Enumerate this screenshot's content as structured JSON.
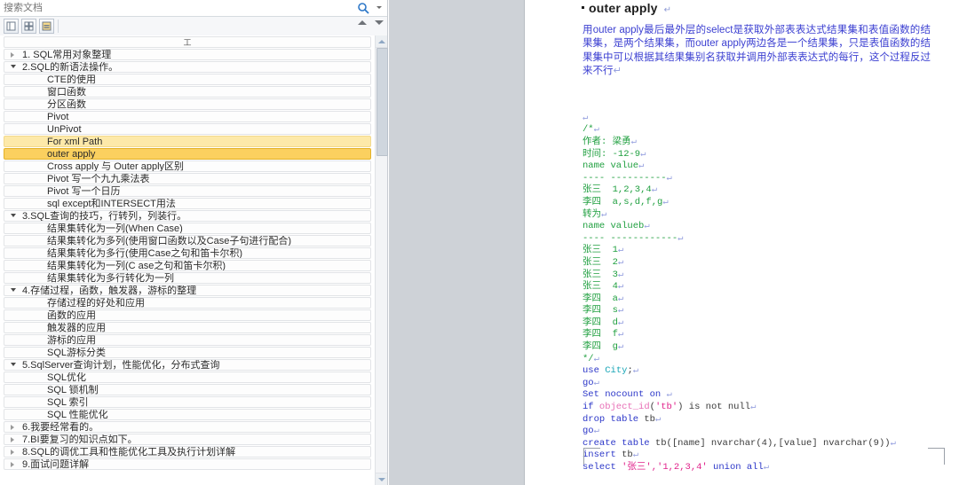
{
  "nav": {
    "search": {
      "placeholder": "搜索文档",
      "value": "",
      "icon": "search-icon",
      "caret_icon": "chevron-down-icon"
    },
    "toolbar": {
      "buttons": [
        {
          "name": "view-outline-button",
          "glyph": "▤"
        },
        {
          "name": "view-thumbnails-button",
          "glyph": "⊞"
        },
        {
          "name": "view-pages-button",
          "glyph": "▥"
        }
      ],
      "nav_up": "▲",
      "nav_down": "▼"
    },
    "list_header": "工",
    "items": [
      {
        "label": "1. SQL常用对象整理",
        "level": 0,
        "state": "collapsed",
        "style": "normal"
      },
      {
        "label": "2.SQL的新语法操作。",
        "level": 0,
        "state": "expanded",
        "style": "normal"
      },
      {
        "label": "CTE的使用",
        "level": 1,
        "state": "none",
        "style": "normal"
      },
      {
        "label": "窗口函数",
        "level": 1,
        "state": "none",
        "style": "normal"
      },
      {
        "label": "分区函数",
        "level": 1,
        "state": "none",
        "style": "normal"
      },
      {
        "label": "Pivot",
        "level": 1,
        "state": "none",
        "style": "normal"
      },
      {
        "label": "UnPivot",
        "level": 1,
        "state": "none",
        "style": "normal"
      },
      {
        "label": "For xml Path",
        "level": 1,
        "state": "none",
        "style": "hover"
      },
      {
        "label": "outer apply",
        "level": 1,
        "state": "none",
        "style": "selected"
      },
      {
        "label": "Cross apply 与 Outer apply区别",
        "level": 1,
        "state": "none",
        "style": "normal"
      },
      {
        "label": "Pivot 写一个九九乘法表",
        "level": 1,
        "state": "none",
        "style": "normal"
      },
      {
        "label": "Pivot 写一个日历",
        "level": 1,
        "state": "none",
        "style": "normal"
      },
      {
        "label": "sql except和INTERSECT用法",
        "level": 1,
        "state": "none",
        "style": "normal"
      },
      {
        "label": "3.SQL查询的技巧，行转列，列装行。",
        "level": 0,
        "state": "expanded",
        "style": "normal"
      },
      {
        "label": "结果集转化为一列(When Case)",
        "level": 1,
        "state": "none",
        "style": "normal"
      },
      {
        "label": "结果集转化为多列(使用窗口函数以及Case子句进行配合)",
        "level": 1,
        "state": "none",
        "style": "normal"
      },
      {
        "label": "结果集转化为多行(使用Case之句和笛卡尔积)",
        "level": 1,
        "state": "none",
        "style": "normal"
      },
      {
        "label": "结果集转化为一列(C ase之句和笛卡尔积)",
        "level": 1,
        "state": "none",
        "style": "normal"
      },
      {
        "label": "结果集转化为多行转化为一列",
        "level": 1,
        "state": "none",
        "style": "normal"
      },
      {
        "label": "4.存储过程，函数，触发器，游标的整理",
        "level": 0,
        "state": "expanded",
        "style": "normal"
      },
      {
        "label": "存储过程的好处和应用",
        "level": 1,
        "state": "none",
        "style": "normal"
      },
      {
        "label": "函数的应用",
        "level": 1,
        "state": "none",
        "style": "normal"
      },
      {
        "label": "触发器的应用",
        "level": 1,
        "state": "none",
        "style": "normal"
      },
      {
        "label": "游标的应用",
        "level": 1,
        "state": "none",
        "style": "normal"
      },
      {
        "label": "SQL游标分类",
        "level": 1,
        "state": "none",
        "style": "normal"
      },
      {
        "label": "5.SqlServer查询计划，性能优化，分布式查询",
        "level": 0,
        "state": "expanded",
        "style": "normal"
      },
      {
        "label": "SQL优化",
        "level": 1,
        "state": "none",
        "style": "normal"
      },
      {
        "label": "SQL 锁机制",
        "level": 1,
        "state": "none",
        "style": "normal"
      },
      {
        "label": "SQL 索引",
        "level": 1,
        "state": "none",
        "style": "normal"
      },
      {
        "label": "SQL 性能优化",
        "level": 1,
        "state": "none",
        "style": "normal"
      },
      {
        "label": "6.我要经常看的。",
        "level": 0,
        "state": "collapsed",
        "style": "normal"
      },
      {
        "label": "7.BI要复习的知识点如下。",
        "level": 0,
        "state": "collapsed",
        "style": "normal"
      },
      {
        "label": "8.SQL的调优工具和性能优化工具及执行计划详解",
        "level": 0,
        "state": "collapsed",
        "style": "normal"
      },
      {
        "label": "9.面试问题详解",
        "level": 0,
        "state": "collapsed",
        "style": "normal"
      }
    ]
  },
  "document": {
    "title": "outer apply",
    "paragraph": "用outer apply最后最外层的select是获取外部表表达式结果集和表值函数的结果集，是两个结果集，而outer apply两边各是一个结果集，只是表值函数的结果集中可以根据其结果集别名获取并调用外部表表达式的每行，这个过程反过来不行",
    "code_lines": [
      {
        "tokens": [
          {
            "t": "",
            "c": "pl"
          }
        ]
      },
      {
        "tokens": [
          {
            "t": "/*",
            "c": "cm"
          }
        ]
      },
      {
        "tokens": [
          {
            "t": "作者: 梁勇",
            "c": "cm"
          }
        ]
      },
      {
        "tokens": [
          {
            "t": "时间: -12-9",
            "c": "cm"
          }
        ]
      },
      {
        "tokens": [
          {
            "t": "name value",
            "c": "cm"
          }
        ]
      },
      {
        "tokens": [
          {
            "t": "---- ----------",
            "c": "cm"
          }
        ]
      },
      {
        "tokens": [
          {
            "t": "张三  1,2,3,4",
            "c": "cm"
          }
        ]
      },
      {
        "tokens": [
          {
            "t": "李四  a,s,d,f,g",
            "c": "cm"
          }
        ]
      },
      {
        "tokens": [
          {
            "t": "转为",
            "c": "cm"
          }
        ]
      },
      {
        "tokens": [
          {
            "t": "name valueb",
            "c": "cm"
          }
        ]
      },
      {
        "tokens": [
          {
            "t": "---- ------------",
            "c": "cm"
          }
        ]
      },
      {
        "tokens": [
          {
            "t": "张三  1",
            "c": "cm"
          }
        ]
      },
      {
        "tokens": [
          {
            "t": "张三  2",
            "c": "cm"
          }
        ]
      },
      {
        "tokens": [
          {
            "t": "张三  3",
            "c": "cm"
          }
        ]
      },
      {
        "tokens": [
          {
            "t": "张三  4",
            "c": "cm"
          }
        ]
      },
      {
        "tokens": [
          {
            "t": "李四  a",
            "c": "cm"
          }
        ]
      },
      {
        "tokens": [
          {
            "t": "李四  s",
            "c": "cm"
          }
        ]
      },
      {
        "tokens": [
          {
            "t": "李四  d",
            "c": "cm"
          }
        ]
      },
      {
        "tokens": [
          {
            "t": "李四  f",
            "c": "cm"
          }
        ]
      },
      {
        "tokens": [
          {
            "t": "李四  g",
            "c": "cm"
          }
        ]
      },
      {
        "tokens": [
          {
            "t": "*/",
            "c": "cm"
          }
        ]
      },
      {
        "tokens": [
          {
            "t": "use ",
            "c": "kw"
          },
          {
            "t": "City",
            "c": "id"
          },
          {
            "t": ";",
            "c": "pl"
          }
        ]
      },
      {
        "tokens": [
          {
            "t": "go",
            "c": "kw"
          }
        ]
      },
      {
        "tokens": [
          {
            "t": "Set nocount on ",
            "c": "kw"
          }
        ]
      },
      {
        "tokens": [
          {
            "t": "if ",
            "c": "kw"
          },
          {
            "t": "object_id",
            "c": "fn"
          },
          {
            "t": "(",
            "c": "pl"
          },
          {
            "t": "'tb'",
            "c": "str"
          },
          {
            "t": ") ",
            "c": "pl"
          },
          {
            "t": "is not null",
            "c": "pl"
          }
        ]
      },
      {
        "tokens": [
          {
            "t": "drop table ",
            "c": "kw"
          },
          {
            "t": "tb",
            "c": "pl"
          }
        ]
      },
      {
        "tokens": [
          {
            "t": "go",
            "c": "kw"
          }
        ]
      },
      {
        "tokens": [
          {
            "t": "create table ",
            "c": "kw"
          },
          {
            "t": "tb([name] nvarchar(4),[value] nvarchar(9))",
            "c": "pl"
          }
        ]
      },
      {
        "tokens": [
          {
            "t": "insert ",
            "c": "kw"
          },
          {
            "t": "tb",
            "c": "pl"
          }
        ]
      },
      {
        "tokens": [
          {
            "t": "select ",
            "c": "kw"
          },
          {
            "t": "'张三','1,2,3,4'",
            "c": "str"
          },
          {
            "t": " union all",
            "c": "kw"
          }
        ]
      }
    ],
    "eop_mark": "↵"
  }
}
